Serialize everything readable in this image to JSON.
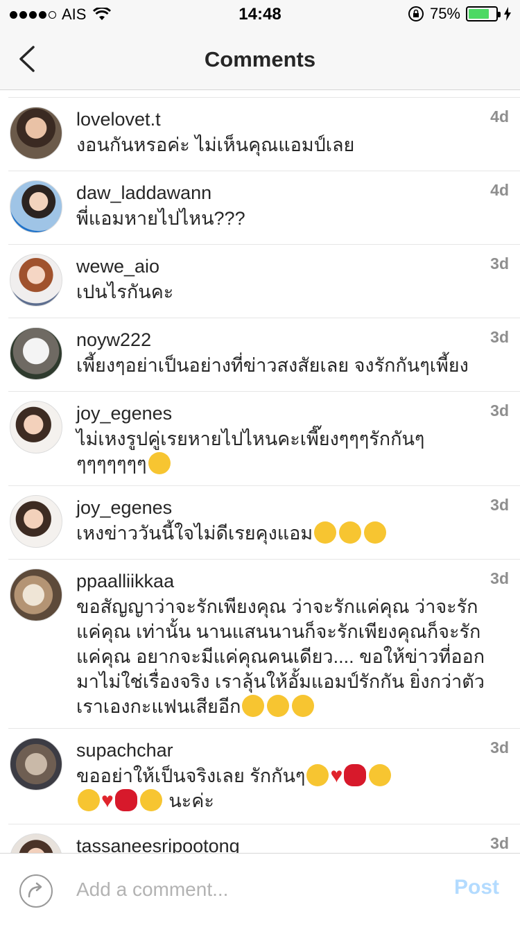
{
  "status_bar": {
    "carrier": "AIS",
    "time": "14:48",
    "battery": "75%",
    "battery_level": 0.75
  },
  "header": {
    "title": "Comments"
  },
  "comments": [
    {
      "username": "lovelovet.t",
      "text": "งอนกันหรอค่ะ ไม่เห็นคุณแอมป์เลย",
      "time": "4d"
    },
    {
      "username": "daw_laddawann",
      "text": "พี่แอมหายไปไหน???",
      "time": "4d"
    },
    {
      "username": "wewe_aio",
      "text": "เปนไรกันคะ",
      "time": "3d"
    },
    {
      "username": "noyw222",
      "text": "เพี้ยงๆอย่าเป็นอย่างที่ข่าวสงสัยเลย  จงรักกันๆเพี้ยง",
      "time": "3d"
    },
    {
      "username": "joy_egenes",
      "text": "ไม่เหงรูปคู่เรยหายไปไหนคะเพี๊ยงๆๆๆรักกันๆ",
      "text2": "ๆๆๆๆๆๆๆ",
      "time": "3d"
    },
    {
      "username": "joy_egenes",
      "text": "เหงข่าววันนี้ใจไม่ดีเรยคุงแอม",
      "time": "3d"
    },
    {
      "username": "ppaalliikkaa",
      "text": "ขอสัญญาว่าจะรักเพียงคุณ ว่าจะรักแค่คุณ ว่าจะรักแค่คุณ เท่านั้น นานแสนนานก็จะรักเพียงคุณก็จะรักแค่คุณ อยากจะมีแค่คุณคนเดียว.... ขอให้ข่าวที่ออกมาไม่ใช่เรื่องจริง เราลุ้นให้อั้มแอมป์รักกัน ยิ่งกว่าตัวเราเองกะแฟนเสียอีก",
      "time": "3d"
    },
    {
      "username": "supachchar",
      "text": "ขออย่าให้เป็นจริงเลย รักกันๆ",
      "text2": "นะค่ะ",
      "time": "3d"
    },
    {
      "username": "tassaneesripootong",
      "text": "",
      "time": "3d"
    }
  ],
  "input": {
    "placeholder": "Add a comment...",
    "post_label": "Post"
  },
  "colors": {
    "post_disabled": "#b3dbff",
    "timestamp": "#8e8e8e",
    "battery": "#4cd964"
  }
}
